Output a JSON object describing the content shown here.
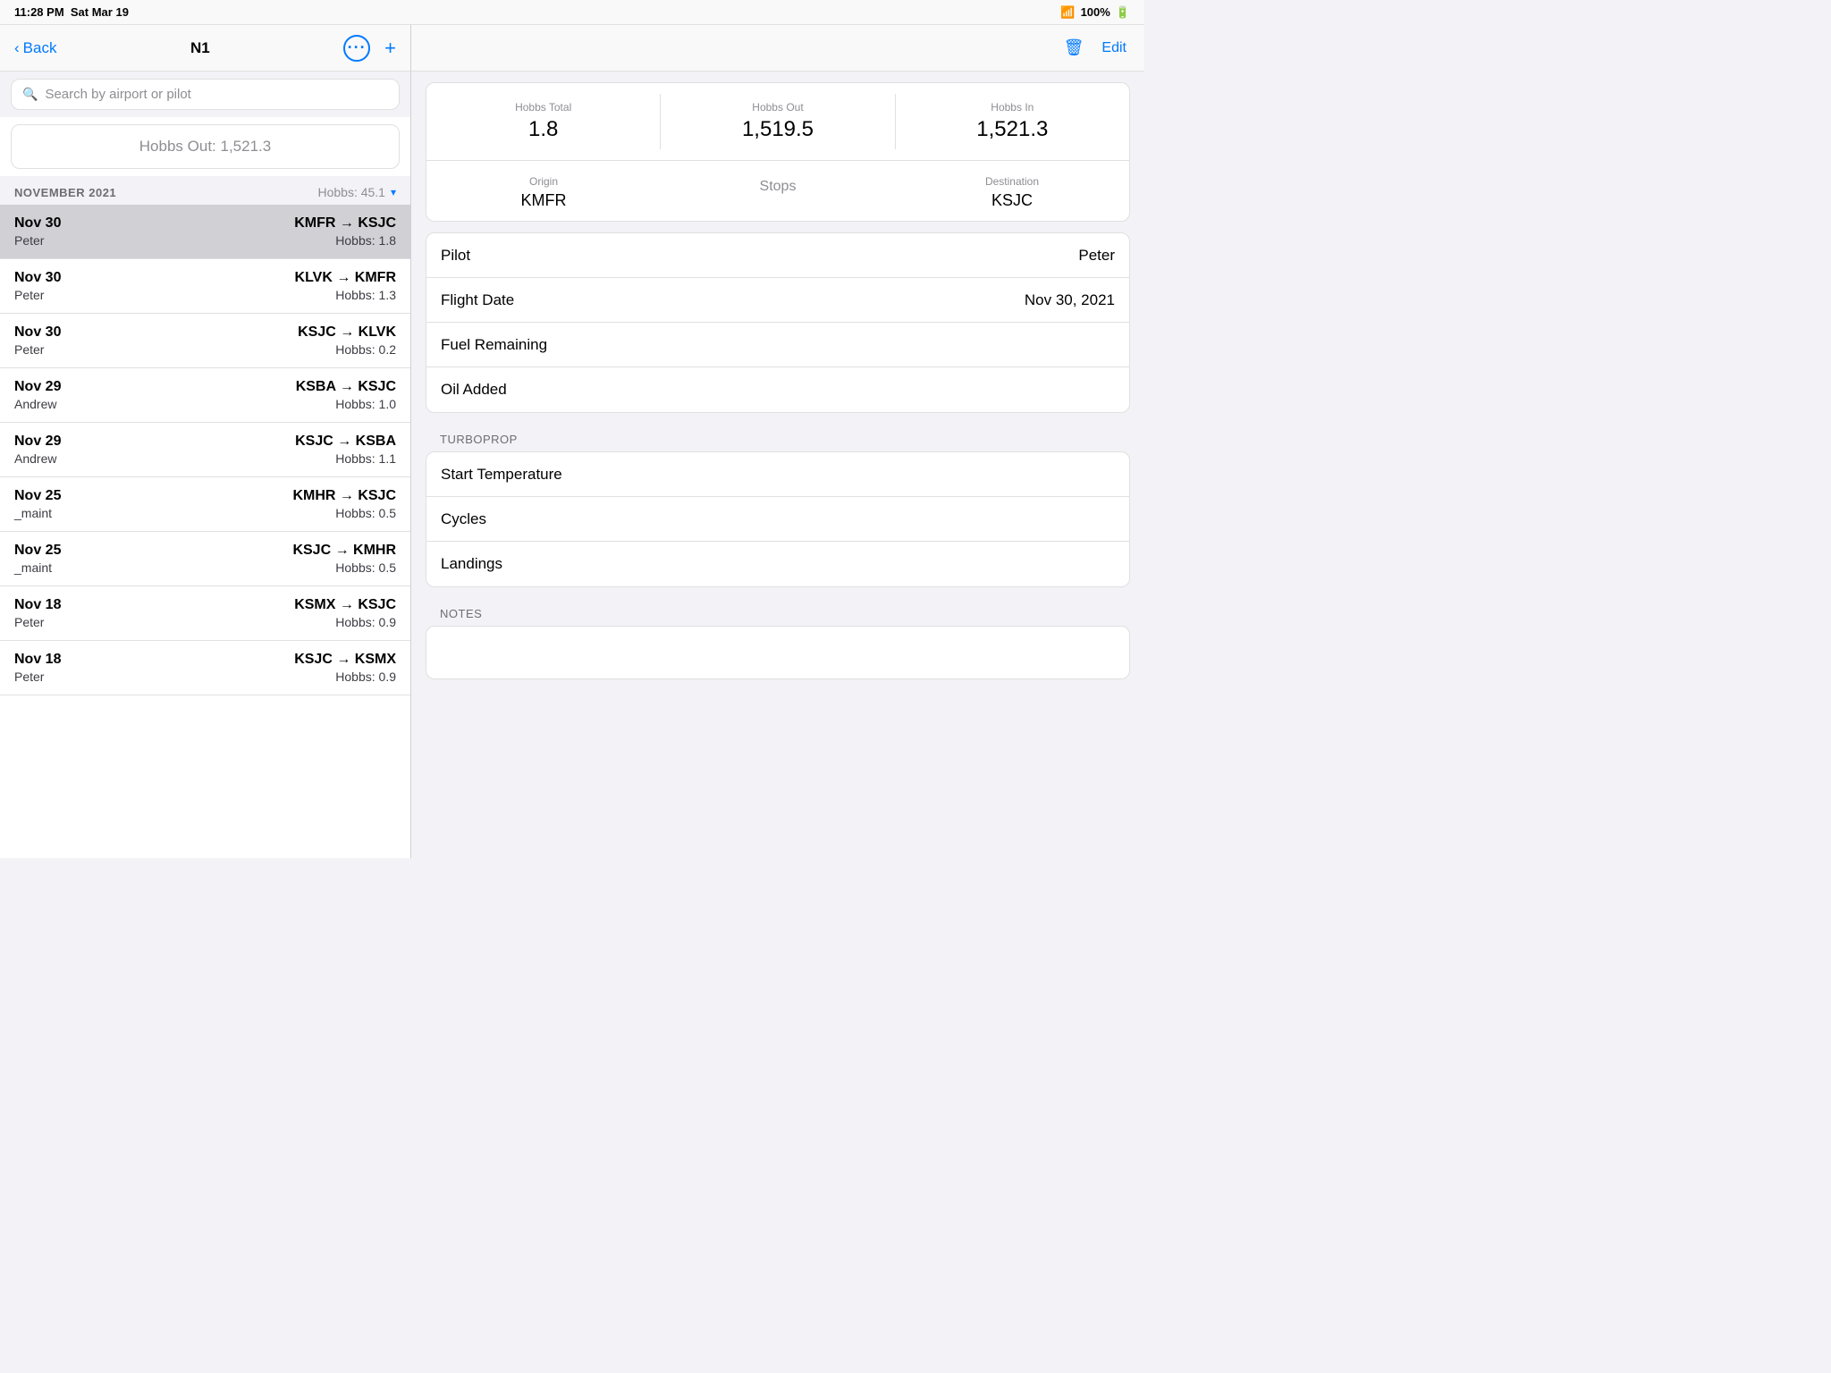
{
  "statusBar": {
    "time": "11:28 PM",
    "date": "Sat Mar 19",
    "wifi": "📶",
    "battery": "100%"
  },
  "leftPanel": {
    "nav": {
      "backLabel": "Back",
      "title": "N1",
      "moreButton": "···",
      "addButton": "+"
    },
    "search": {
      "placeholder": "Search by airport or pilot"
    },
    "hobbsBanner": {
      "label": "Hobbs Out: 1,521.3"
    },
    "section": {
      "title": "NOVEMBER 2021",
      "hobbs": "Hobbs: 45.1"
    },
    "flights": [
      {
        "date": "Nov 30",
        "pilot": "Peter",
        "route": "KMFR → KSJC",
        "hobbs": "Hobbs:  1.8",
        "selected": true
      },
      {
        "date": "Nov 30",
        "pilot": "Peter",
        "route": "KLVK → KMFR",
        "hobbs": "Hobbs:  1.3",
        "selected": false
      },
      {
        "date": "Nov 30",
        "pilot": "Peter",
        "route": "KSJC → KLVK",
        "hobbs": "Hobbs:  0.2",
        "selected": false
      },
      {
        "date": "Nov 29",
        "pilot": "Andrew",
        "route": "KSBA → KSJC",
        "hobbs": "Hobbs:  1.0",
        "selected": false
      },
      {
        "date": "Nov 29",
        "pilot": "Andrew",
        "route": "KSJC → KSBA",
        "hobbs": "Hobbs:  1.1",
        "selected": false
      },
      {
        "date": "Nov 25",
        "pilot": "_maint",
        "route": "KMHR → KSJC",
        "hobbs": "Hobbs:  0.5",
        "selected": false
      },
      {
        "date": "Nov 25",
        "pilot": "_maint",
        "route": "KSJC → KMHR",
        "hobbs": "Hobbs:  0.5",
        "selected": false
      },
      {
        "date": "Nov 18",
        "pilot": "Peter",
        "route": "KSMX → KSJC",
        "hobbs": "Hobbs:  0.9",
        "selected": false
      },
      {
        "date": "Nov 18",
        "pilot": "Peter",
        "route": "KSJC → KSMX",
        "hobbs": "Hobbs:  0.9",
        "selected": false
      }
    ]
  },
  "rightPanel": {
    "editButton": "Edit",
    "hobbsSummary": {
      "totalLabel": "Hobbs Total",
      "totalValue": "1.8",
      "outLabel": "Hobbs Out",
      "outValue": "1,519.5",
      "inLabel": "Hobbs In",
      "inValue": "1,521.3"
    },
    "route": {
      "originLabel": "Origin",
      "originValue": "KMFR",
      "stopsLabel": "Stops",
      "stopsValue": "Stops",
      "destinationLabel": "Destination",
      "destinationValue": "KSJC"
    },
    "infoRows": [
      {
        "key": "Pilot",
        "value": "Peter"
      },
      {
        "key": "Flight Date",
        "value": "Nov 30, 2021"
      },
      {
        "key": "Fuel Remaining",
        "value": ""
      },
      {
        "key": "Oil Added",
        "value": ""
      }
    ],
    "turbopropLabel": "TURBOPROP",
    "turbopropRows": [
      {
        "key": "Start Temperature",
        "value": ""
      },
      {
        "key": "Cycles",
        "value": ""
      },
      {
        "key": "Landings",
        "value": ""
      }
    ],
    "notesLabel": "NOTES"
  }
}
